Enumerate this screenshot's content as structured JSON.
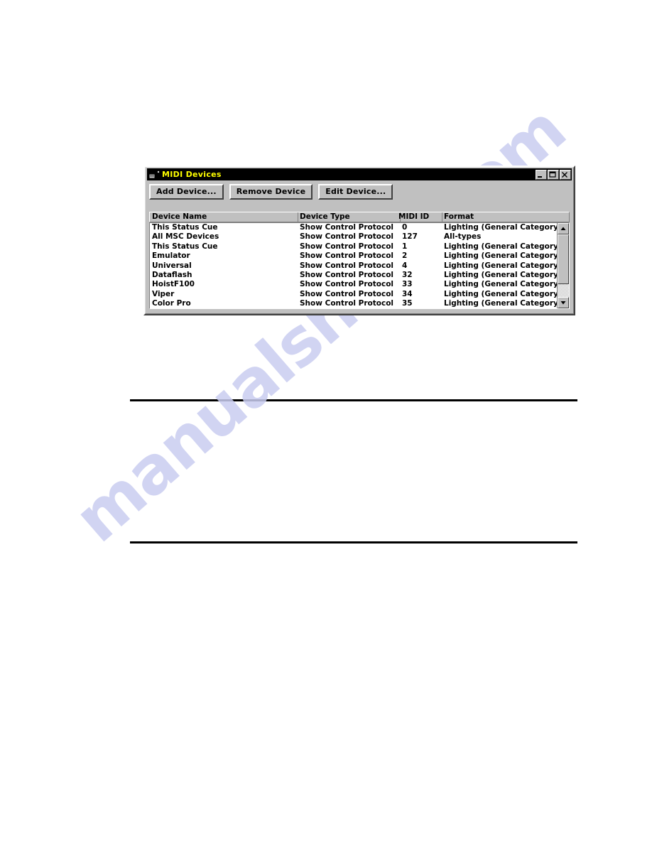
{
  "page": {
    "background_color": "#ffffff",
    "watermark_text": "manualshive.com",
    "watermark_color": "#c9cdf0",
    "rules": [
      "divider-rule-top",
      "divider-rule-bottom"
    ]
  },
  "dialog": {
    "title": "MIDI Devices",
    "title_icon": "midi-device-icon",
    "title_bar_color": "#000000",
    "title_text_color": "#ffff00",
    "face_color": "#c0c0c0",
    "window_controls": [
      {
        "name": "minimize-button",
        "glyph": "_",
        "label": "Minimize"
      },
      {
        "name": "maximize-button",
        "glyph": "□",
        "label": "Maximize"
      },
      {
        "name": "close-button",
        "glyph": "✕",
        "label": "Close"
      }
    ],
    "toolbar": {
      "add_device_label": "Add Device...",
      "remove_device_label": "Remove Device",
      "edit_device_label": "Edit Device..."
    },
    "list": {
      "columns": [
        {
          "key": "device_name",
          "label": "Device Name"
        },
        {
          "key": "device_type",
          "label": "Device Type"
        },
        {
          "key": "midi_id",
          "label": "MIDI ID"
        },
        {
          "key": "format",
          "label": "Format"
        }
      ],
      "rows": [
        {
          "device_name": "This Status Cue",
          "device_type": "Show Control Protocol",
          "midi_id": "0",
          "format": "Lighting (General Category)"
        },
        {
          "device_name": "All MSC Devices",
          "device_type": "Show Control Protocol",
          "midi_id": "127",
          "format": "All-types"
        },
        {
          "device_name": "This Status Cue",
          "device_type": "Show Control Protocol",
          "midi_id": "1",
          "format": "Lighting (General Category)"
        },
        {
          "device_name": "Emulator",
          "device_type": "Show Control Protocol",
          "midi_id": "2",
          "format": "Lighting (General Category)"
        },
        {
          "device_name": "Universal",
          "device_type": "Show Control Protocol",
          "midi_id": "4",
          "format": "Lighting (General Category)"
        },
        {
          "device_name": "Dataflash",
          "device_type": "Show Control Protocol",
          "midi_id": "32",
          "format": "Lighting (General Category)"
        },
        {
          "device_name": "HoistF100",
          "device_type": "Show Control Protocol",
          "midi_id": "33",
          "format": "Lighting (General Category)"
        },
        {
          "device_name": "Viper",
          "device_type": "Show Control Protocol",
          "midi_id": "34",
          "format": "Lighting (General Category)"
        },
        {
          "device_name": "Color Pro",
          "device_type": "Show Control Protocol",
          "midi_id": "35",
          "format": "Lighting (General Category)"
        }
      ],
      "scrollbar": {
        "up_arrow": "scroll-up-arrow-icon",
        "down_arrow": "scroll-down-arrow-icon",
        "thumb_position_percent": 0,
        "thumb_size_percent": 80
      }
    }
  }
}
